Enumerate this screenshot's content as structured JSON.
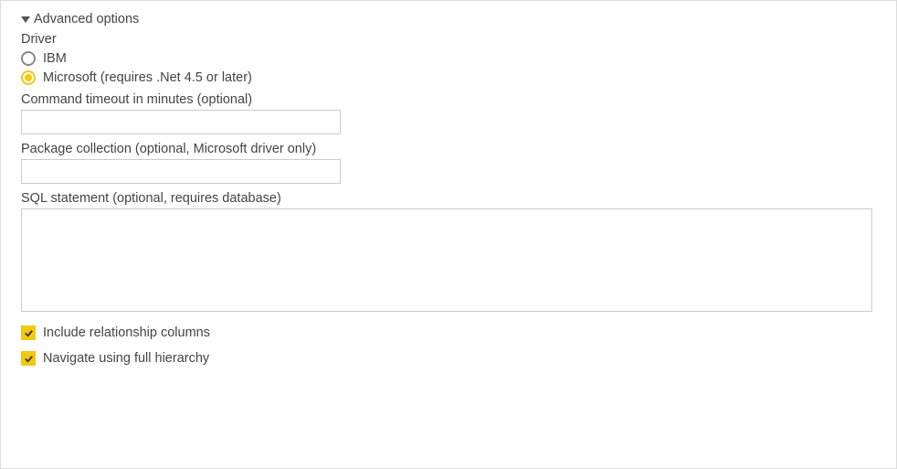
{
  "section": {
    "title": "Advanced options"
  },
  "driver": {
    "label": "Driver",
    "options": [
      {
        "label": "IBM",
        "selected": false
      },
      {
        "label": "Microsoft (requires .Net 4.5 or later)",
        "selected": true
      }
    ]
  },
  "timeout": {
    "label": "Command timeout in minutes (optional)",
    "value": ""
  },
  "package": {
    "label": "Package collection (optional, Microsoft driver only)",
    "value": ""
  },
  "sql": {
    "label": "SQL statement (optional, requires database)",
    "value": ""
  },
  "checkboxes": {
    "relationship": {
      "label": "Include relationship columns",
      "checked": true
    },
    "hierarchy": {
      "label": "Navigate using full hierarchy",
      "checked": true
    }
  }
}
